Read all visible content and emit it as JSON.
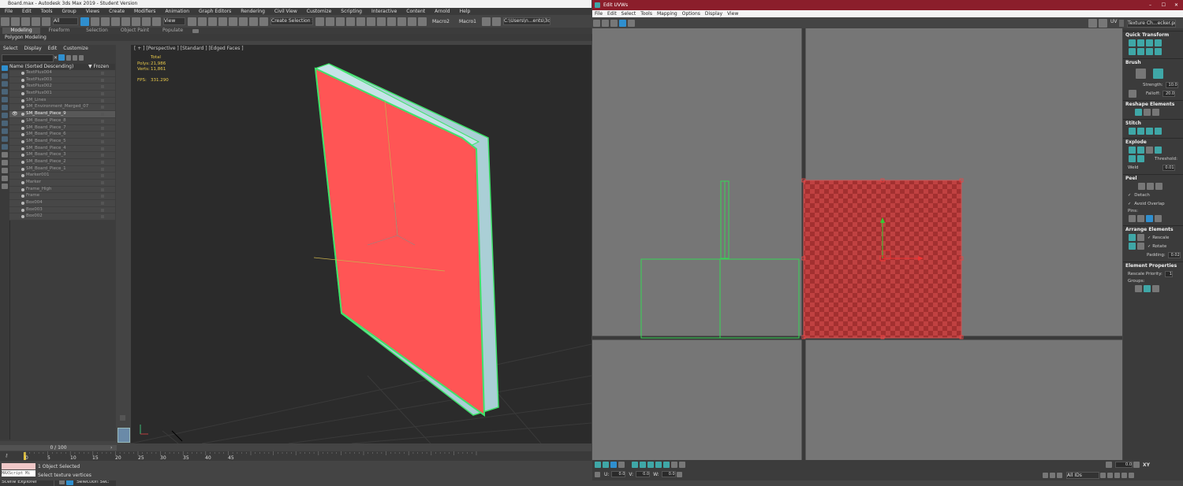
{
  "max": {
    "title": "Board.max - Autodesk 3ds Max 2019 - Student Version",
    "menu": [
      "File",
      "Edit",
      "Tools",
      "Group",
      "Views",
      "Create",
      "Modifiers",
      "Animation",
      "Graph Editors",
      "Rendering",
      "Civil View",
      "Customize",
      "Scripting",
      "Interactive",
      "Content",
      "Arnold",
      "Help"
    ],
    "toolbar": {
      "filter": "All",
      "ref_coord": "View",
      "selection_set": "Create Selection Se",
      "macro1": "Macro1",
      "macro2": "Macro2",
      "project_path": "C:\\Users\\n...ents\\3dsMax"
    },
    "ribbon_tabs": [
      "Modeling",
      "Freeform",
      "Selection",
      "Object Paint",
      "Populate"
    ],
    "ribbon_sub": "Polygon Modeling"
  },
  "scene_explorer": {
    "menu": [
      "Select",
      "Display",
      "Edit",
      "Customize"
    ],
    "col_name": "Name (Sorted Descending)",
    "col_frozen": "▼ Frozen",
    "items": [
      "TextPlus004",
      "TextPlus003",
      "TextPlus002",
      "TextPlus001",
      "SM_Lines",
      "SM_Environment_Merged_07",
      "SM_Board_Piece_9",
      "SM_Board_Piece_8",
      "SM_Board_Piece_7",
      "SM_Board_Piece_6",
      "SM_Board_Piece_5",
      "SM_Board_Piece_4",
      "SM_Board_Piece_3",
      "SM_Board_Piece_2",
      "SM_Board_Piece_1",
      "Marker001",
      "Marker",
      "Frame_High",
      "Frame",
      "Box004",
      "Box003",
      "Box002"
    ],
    "selected_index": 6,
    "footer_label": "Scene Explorer",
    "selection_set_label": "Selection Set:"
  },
  "viewport": {
    "label": "[ + ] [Perspective ] [Standard ] [Edged Faces ]",
    "stats": {
      "total_label": "Total",
      "polys_label": "Polys:",
      "polys": "21,986",
      "verts_label": "Verts:",
      "verts": "11,861",
      "fps_label": "FPS:",
      "fps": "331.290"
    }
  },
  "timeline": {
    "frame": "0 / 100",
    "ticks": [
      "0",
      "5",
      "10",
      "15",
      "20",
      "25",
      "30",
      "35",
      "40",
      "45"
    ]
  },
  "status": {
    "line1": "1 Object Selected",
    "line2": "Select texture vertices",
    "maxscript": "MAXScript Mi"
  },
  "uv_editor": {
    "title": "Edit UVWs",
    "menu": [
      "File",
      "Edit",
      "Select",
      "Tools",
      "Mapping",
      "Options",
      "Display",
      "View"
    ],
    "uv_label": "UV",
    "texture_dropdown": "Texture Ch...ecker.png)",
    "panel": {
      "quick_transform": "Quick Transform",
      "brush": "Brush",
      "strength_label": "Strength:",
      "strength": "10.0",
      "falloff_label": "Falloff:",
      "falloff": "20.0",
      "reshape": "Reshape Elements",
      "stitch": "Stitch",
      "explode": "Explode",
      "weld_label": "Weld",
      "threshold_label": "Threshold:",
      "threshold": "0.01",
      "peel": "Peel",
      "detach_label": "Detach",
      "avoid_overlap_label": "Avoid Overlap",
      "pins_label": "Pins:",
      "arrange": "Arrange Elements",
      "rescale_label": "Rescale",
      "rotate_label": "Rotate",
      "padding_label": "Padding:",
      "padding": "0.02",
      "element_props": "Element Properties",
      "rescale_priority_label": "Rescale Priority:",
      "rescale_priority": "1",
      "groups_label": "Groups:"
    },
    "bottom": {
      "u_label": "U:",
      "u": "0.0",
      "v_label": "V:",
      "v": "0.0",
      "w_label": "W:",
      "w": "0.0",
      "zoom": "0.0",
      "ids": "All IDs",
      "xy": "XY"
    }
  }
}
